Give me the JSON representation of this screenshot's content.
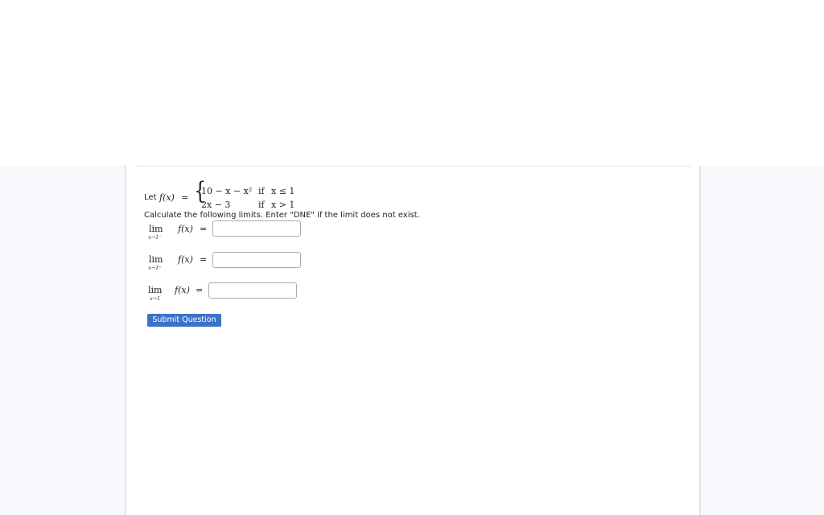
{
  "problem": {
    "intro_label": "Let",
    "function": "f(x)",
    "equals": "=",
    "cases": [
      {
        "expr": "10 − x − x²",
        "cond_kw": "if",
        "cond": "x ≤ 1"
      },
      {
        "expr": "2x − 3",
        "cond_kw": "if",
        "cond": "x > 1"
      }
    ],
    "instructions": "Calculate the following limits. Enter \"DNE\" if the limit does not exist.",
    "limits": [
      {
        "lim": "lim",
        "approach": "x→1⁻",
        "func": "f(x)",
        "eq": "=",
        "value": "",
        "placeholder": ""
      },
      {
        "lim": "lim",
        "approach": "x→1⁺",
        "func": "f(x)",
        "eq": "=",
        "value": "",
        "placeholder": ""
      },
      {
        "lim": "lim",
        "approach": "x→1",
        "func": "f(x)",
        "eq": "=",
        "value": "",
        "placeholder": ""
      }
    ]
  },
  "submit_label": "Submit Question",
  "colors": {
    "accent": "#3b73c8",
    "page_bg": "#f7f8fb",
    "card_border": "#e1e3e8"
  }
}
